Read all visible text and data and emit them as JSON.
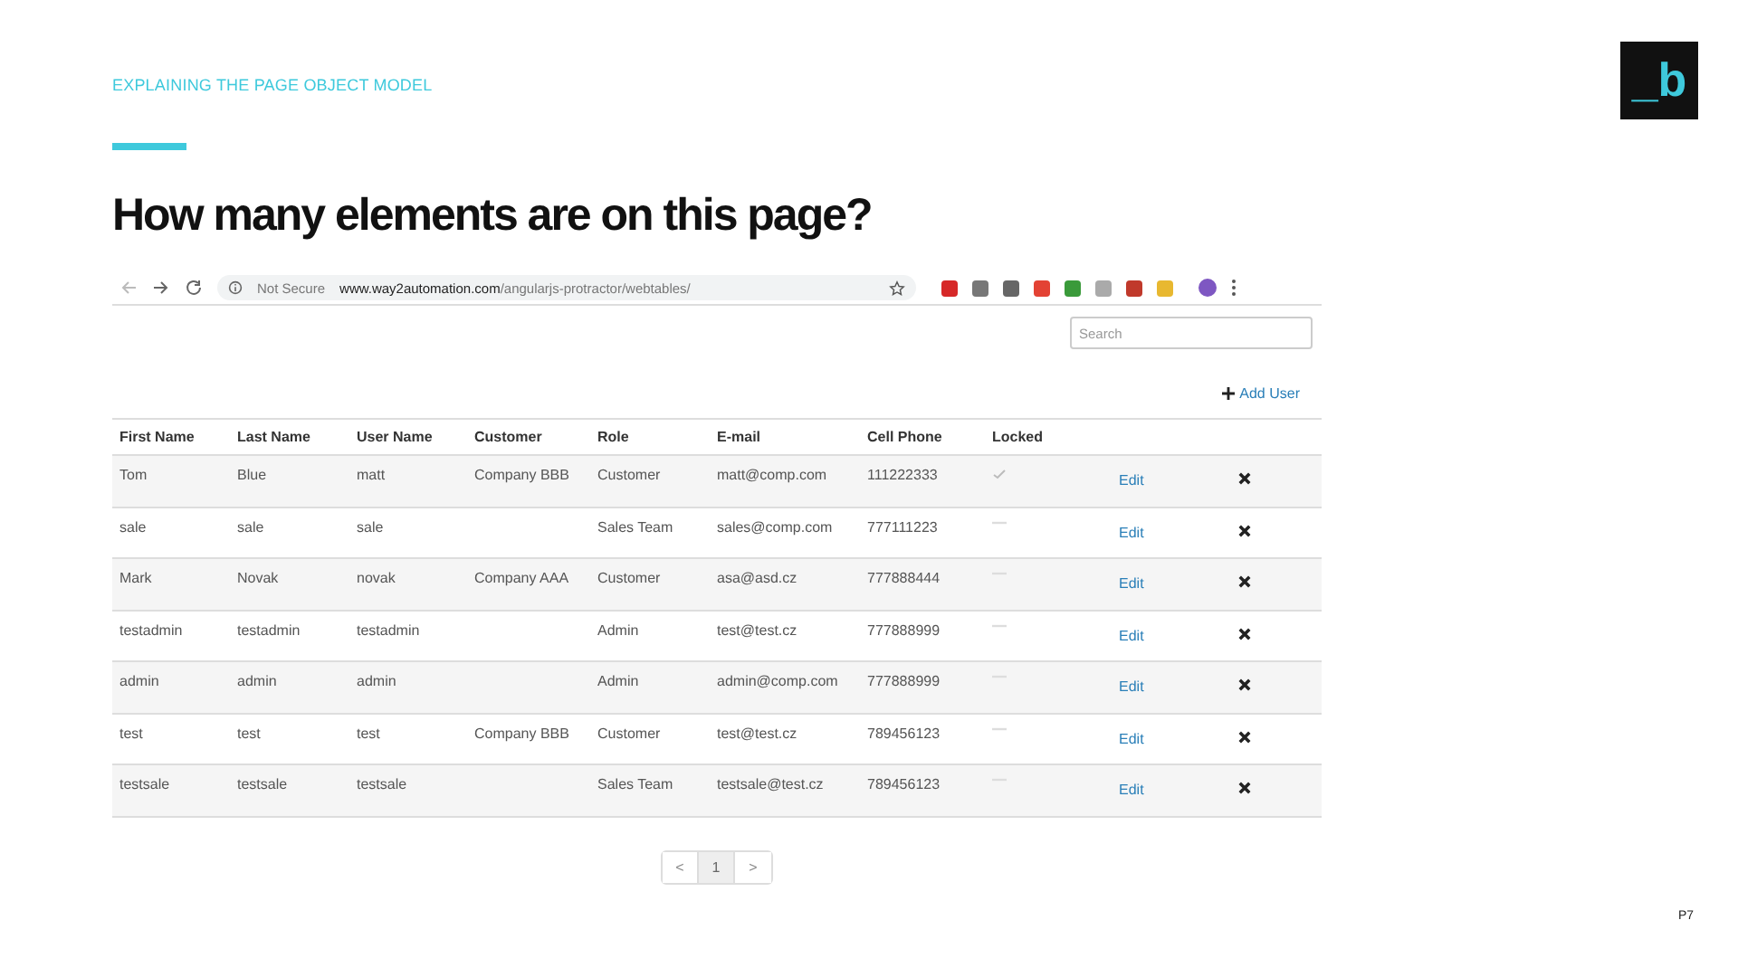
{
  "slide": {
    "kicker": "EXPLAINING THE PAGE OBJECT MODEL",
    "title": "How many elements are on this page?",
    "logo": "_b",
    "page_number": "P7"
  },
  "browser": {
    "security": "Not Secure",
    "url": "**www.way2automation.com**/angularjs-protractor/webtables/"
  },
  "search": {
    "placeholder": "Search"
  },
  "add_user": "Add User",
  "table": {
    "columns": [
      "First Name",
      "Last Name",
      "User Name",
      "Customer",
      "Role",
      "E-mail",
      "Cell Phone",
      "Locked"
    ],
    "rows": [
      {
        "cells": [
          "Tom",
          "Blue",
          "matt",
          "Company BBB",
          "Customer",
          "matt@comp.com",
          "111222333"
        ],
        "locked": true,
        "edit": "Edit"
      },
      {
        "cells": [
          "sale",
          "sale",
          "sale",
          "",
          "Sales Team",
          "sales@comp.com",
          "777111223"
        ],
        "locked": false,
        "edit": "Edit"
      },
      {
        "cells": [
          "Mark",
          "Novak",
          "novak",
          "Company AAA",
          "Customer",
          "asa@asd.cz",
          "777888444"
        ],
        "locked": false,
        "edit": "Edit"
      },
      {
        "cells": [
          "testadmin",
          "testadmin",
          "testadmin",
          "",
          "Admin",
          "test@test.cz",
          "777888999"
        ],
        "locked": false,
        "edit": "Edit"
      },
      {
        "cells": [
          "admin",
          "admin",
          "admin",
          "",
          "Admin",
          "admin@comp.com",
          "777888999"
        ],
        "locked": false,
        "edit": "Edit"
      },
      {
        "cells": [
          "test",
          "test",
          "test",
          "Company BBB",
          "Customer",
          "test@test.cz",
          "789456123"
        ],
        "locked": false,
        "edit": "Edit"
      },
      {
        "cells": [
          "testsale",
          "testsale",
          "testsale",
          "",
          "Sales Team",
          "testsale@test.cz",
          "789456123"
        ],
        "locked": false,
        "edit": "Edit"
      }
    ]
  },
  "pager": [
    {
      "label": "<",
      "selected": false
    },
    {
      "label": "1",
      "selected": true
    },
    {
      "label": ">",
      "selected": false
    }
  ]
}
